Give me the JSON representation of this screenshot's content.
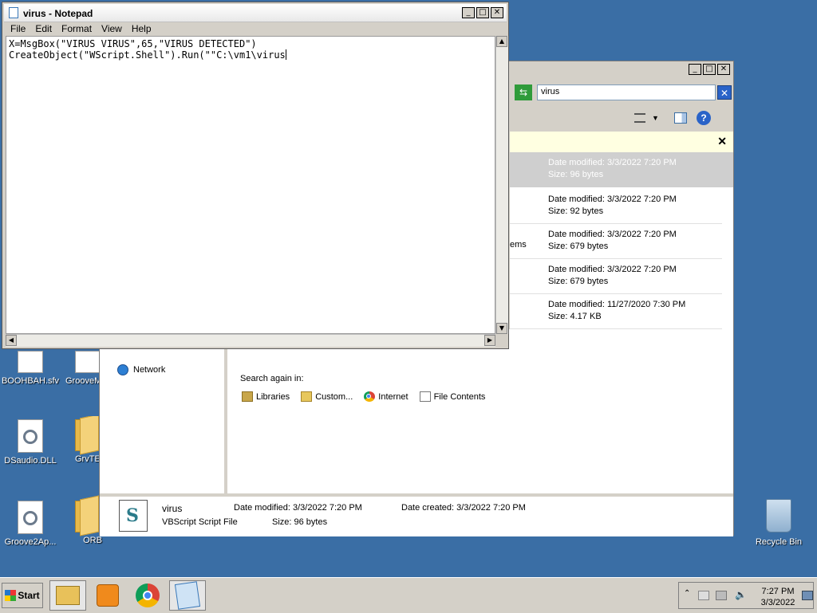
{
  "notepad": {
    "title": "virus - Notepad",
    "menu": [
      "File",
      "Edit",
      "Format",
      "View",
      "Help"
    ],
    "content_line1": "X=MsgBox(\"VIRUS VIRUS\",65,\"VIRUS DETECTED\")",
    "content_line2": "CreateObject(\"WScript.Shell\").Run(\"\"C:\\vm1\\virus"
  },
  "explorer": {
    "search_value": "virus",
    "results": [
      {
        "modified": "Date modified: 3/3/2022 7:20 PM",
        "size": "Size: 96 bytes",
        "selected": true
      },
      {
        "modified": "Date modified: 3/3/2022 7:20 PM",
        "size": "Size: 92 bytes",
        "selected": false
      },
      {
        "modified": "Date modified: 3/3/2022 7:20 PM",
        "size": "Size: 679 bytes",
        "selected": false
      },
      {
        "modified": "Date modified: 3/3/2022 7:20 PM",
        "size": "Size: 679 bytes",
        "selected": false
      },
      {
        "modified": "Date modified: 11/27/2020 7:30 PM",
        "size": "Size: 4.17 KB",
        "selected": false
      }
    ],
    "result_fragment": "ems",
    "nav": {
      "network": "Network"
    },
    "search_again": {
      "label": "Search again in:",
      "items": [
        "Libraries",
        "Custom...",
        "Internet",
        "File Contents"
      ]
    },
    "details": {
      "name": "virus",
      "type": "VBScript Script File",
      "modified": "Date modified:  3/3/2022 7:20 PM",
      "size": "Size:  96 bytes",
      "created": "Date created:  3/3/2022 7:20 PM"
    }
  },
  "desktop_icons": [
    {
      "label": "BOOHBAH.sfv",
      "icon": "gear-file-icon"
    },
    {
      "label": "GrooveM",
      "icon": "gear-file-icon"
    },
    {
      "label": "DSaudio.DLL",
      "icon": "gear-file-icon"
    },
    {
      "label": "GrvTE",
      "icon": "folder-icon"
    },
    {
      "label": "Groove2Ap...",
      "icon": "gear-file-icon"
    },
    {
      "label": "ORB",
      "icon": "folder-icon"
    },
    {
      "label": "Recycle Bin",
      "icon": "recycle-bin-icon"
    }
  ],
  "taskbar": {
    "start_label": "Start",
    "time": "7:27 PM",
    "date": "3/3/2022"
  }
}
